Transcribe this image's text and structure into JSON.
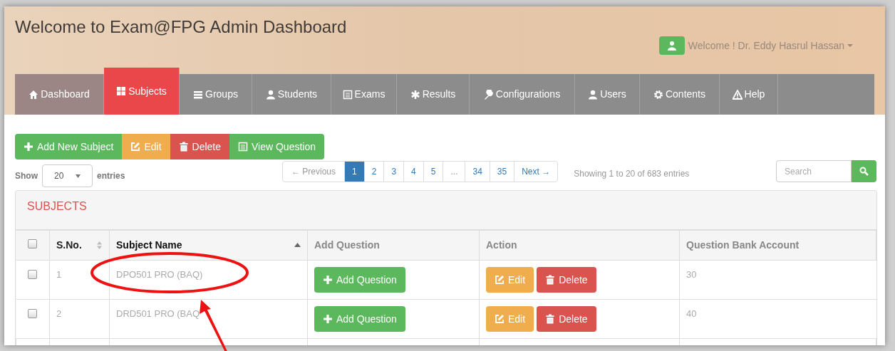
{
  "header": {
    "title": "Welcome to Exam@FPG Admin Dashboard",
    "user": "Welcome ! Dr. Eddy Hasrul Hassan"
  },
  "nav": [
    {
      "label": "Dashboard",
      "selected": false,
      "highlighted": true
    },
    {
      "label": "Subjects",
      "selected": true,
      "highlighted": false
    },
    {
      "label": "Groups",
      "selected": false,
      "highlighted": false
    },
    {
      "label": "Students",
      "selected": false,
      "highlighted": false
    },
    {
      "label": "Exams",
      "selected": false,
      "highlighted": false
    },
    {
      "label": "Results",
      "selected": false,
      "highlighted": false
    },
    {
      "label": "Configurations",
      "selected": false,
      "highlighted": false
    },
    {
      "label": "Users",
      "selected": false,
      "highlighted": false
    },
    {
      "label": "Contents",
      "selected": false,
      "highlighted": false
    },
    {
      "label": "Help",
      "selected": false,
      "highlighted": false
    }
  ],
  "toolbar": [
    {
      "label": "Add New Subject",
      "kind": "add"
    },
    {
      "label": "Edit",
      "kind": "edit"
    },
    {
      "label": "Delete",
      "kind": "delete"
    },
    {
      "label": "View Question",
      "kind": "view"
    }
  ],
  "length": {
    "show": "Show",
    "value": "20",
    "entries": "entries"
  },
  "pagination": [
    {
      "label": "← Previous",
      "selected": false,
      "disabled": true
    },
    {
      "label": "1",
      "selected": true,
      "disabled": false
    },
    {
      "label": "2",
      "selected": false,
      "disabled": false
    },
    {
      "label": "3",
      "selected": false,
      "disabled": false
    },
    {
      "label": "4",
      "selected": false,
      "disabled": false
    },
    {
      "label": "5",
      "selected": false,
      "disabled": false
    },
    {
      "label": "...",
      "selected": false,
      "disabled": true
    },
    {
      "label": "34",
      "selected": false,
      "disabled": false
    },
    {
      "label": "35",
      "selected": false,
      "disabled": false
    },
    {
      "label": "Next →",
      "selected": false,
      "disabled": false
    }
  ],
  "info": "Showing 1 to 20 of 683 entries",
  "search": {
    "placeholder": "Search"
  },
  "panel": {
    "title": "SUBJECTS"
  },
  "table": {
    "header_checked": false,
    "columns": [
      {
        "label": "S.No.",
        "sortable": true,
        "sorted": false
      },
      {
        "label": "Subject Name",
        "sortable": true,
        "sorted": true
      },
      {
        "label": "Add Question",
        "sortable": false,
        "sorted": false
      },
      {
        "label": "Action",
        "sortable": false,
        "sorted": false
      },
      {
        "label": "Question Bank Account",
        "sortable": false,
        "sorted": false
      }
    ],
    "rows": [
      {
        "checked": false,
        "sno": "1",
        "name": "DPO501 PRO (BAQ)",
        "add": "Add Question",
        "edit": "Edit",
        "delete": "Delete",
        "count": "30"
      },
      {
        "checked": false,
        "sno": "2",
        "name": "DRD501 PRO (BAQ",
        "add": "Add Question",
        "edit": "Edit",
        "delete": "Delete",
        "count": "40"
      }
    ]
  }
}
